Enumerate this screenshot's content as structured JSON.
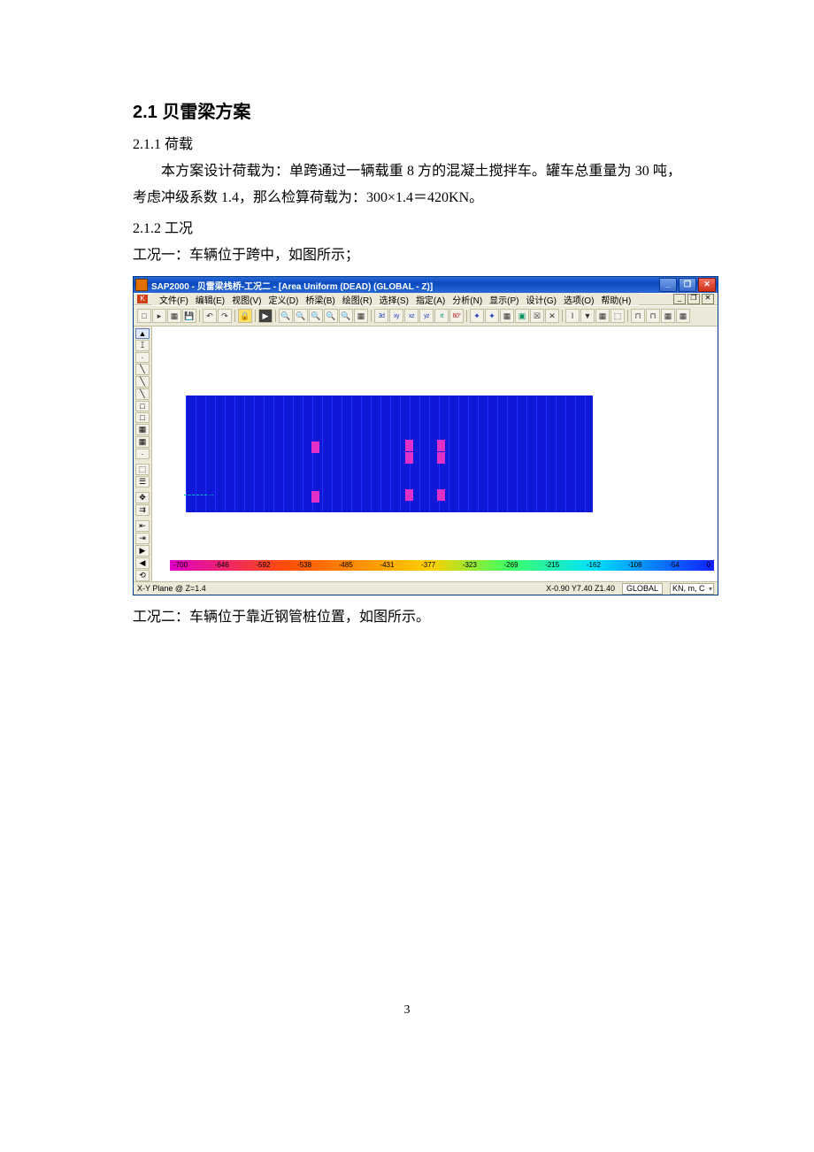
{
  "doc": {
    "heading": "2.1 贝雷梁方案",
    "sub1": "2.1.1 荷载",
    "para1": "本方案设计荷载为：单跨通过一辆载重 8 方的混凝土搅拌车。罐车总重量为 30 吨，考虑冲级系数 1.4，那么检算荷载为：300×1.4＝420KN。",
    "sub2": "2.1.2 工况",
    "case1": "工况一：车辆位于跨中，如图所示；",
    "case2": "工况二：车辆位于靠近钢管桩位置，如图所示。",
    "page_number": "3"
  },
  "app": {
    "title": "SAP2000 - 贝雷梁栈桥-工况二 - [Area Uniform (DEAD) (GLOBAL - Z)]",
    "mdi_icon": "K",
    "win_min": "_",
    "win_max": "❐",
    "win_close": "✕",
    "menu": [
      "文件(F)",
      "编辑(E)",
      "视图(V)",
      "定义(D)",
      "桥梁(B)",
      "绘图(R)",
      "选择(S)",
      "指定(A)",
      "分析(N)",
      "显示(P)",
      "设计(G)",
      "选项(O)",
      "帮助(H)"
    ],
    "toolbar": [
      "□",
      "▸",
      "▦",
      "💾",
      "↶",
      "↷",
      "🔒",
      "▶",
      "🔍",
      "🔍",
      "🔍",
      "🔍",
      "🔍",
      "▦",
      "3d",
      "xy",
      "xz",
      "yz",
      "rt",
      "60°",
      "✦",
      "✦",
      "▦",
      "▣",
      "☒",
      "✕",
      "I",
      "▼",
      "▦",
      "⬚",
      "⊓",
      "⊓",
      "▦",
      "▦"
    ],
    "left_tools": [
      "▲",
      "ꕯ",
      "·",
      "╲",
      "╲",
      "╲",
      "□",
      "□",
      "▦",
      "▦",
      "·",
      "",
      "⬚",
      "☰",
      "",
      "✥",
      "⇉",
      "",
      "⇤",
      "⇥",
      "▶",
      "◀",
      "⟲"
    ],
    "status_left": "X-Y Plane @ Z=1.4",
    "status_coord": "X-0.90 Y7.40 Z1.40",
    "status_global": "GLOBAL",
    "status_units": "KN, m, C"
  },
  "chart_data": {
    "type": "heatmap",
    "title": "Area Uniform (DEAD) (GLOBAL - Z)",
    "legend_values": [
      -700,
      -646,
      -592,
      -538,
      -485,
      -431,
      -377,
      -323,
      -269,
      -215,
      -162,
      -108,
      -54,
      0
    ],
    "units": "KN, m, C"
  }
}
